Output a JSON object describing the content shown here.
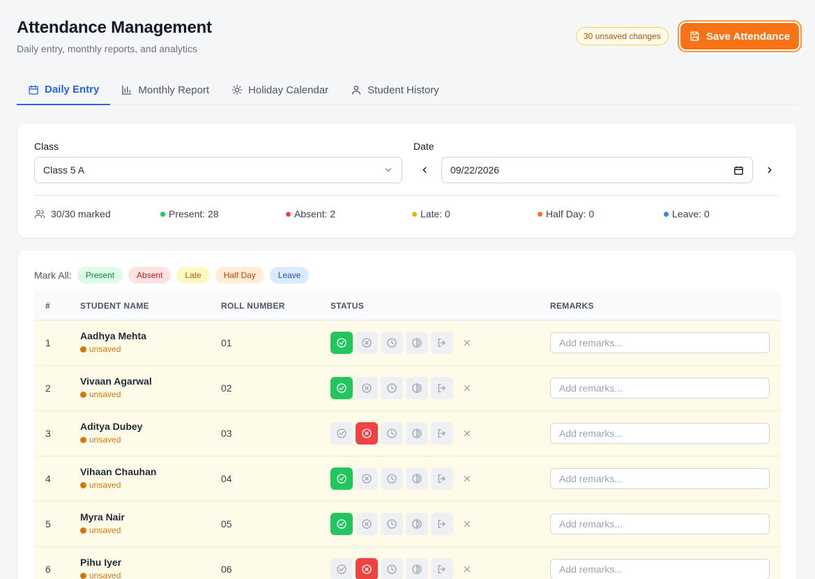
{
  "header": {
    "title": "Attendance Management",
    "subtitle": "Daily entry, monthly reports, and analytics",
    "unsaved_badge": "30 unsaved changes",
    "save_label": "Save Attendance"
  },
  "tabs": [
    {
      "label": "Daily Entry",
      "icon": "calendar-icon",
      "active": true
    },
    {
      "label": "Monthly Report",
      "icon": "bar-chart-icon",
      "active": false
    },
    {
      "label": "Holiday Calendar",
      "icon": "sun-icon",
      "active": false
    },
    {
      "label": "Student History",
      "icon": "user-icon",
      "active": false
    }
  ],
  "filters": {
    "class_label": "Class",
    "class_value": "Class 5 A",
    "date_label": "Date",
    "date_value": "09/22/2026"
  },
  "stats": {
    "marked": "30/30 marked",
    "present": "Present: 28",
    "absent": "Absent: 2",
    "late": "Late: 0",
    "half_day": "Half Day: 0",
    "leave": "Leave: 0"
  },
  "mark_all": {
    "label": "Mark All:",
    "present": "Present",
    "absent": "Absent",
    "late": "Late",
    "half_day": "Half Day",
    "leave": "Leave"
  },
  "table": {
    "headers": {
      "num": "#",
      "name": "STUDENT NAME",
      "roll": "ROLL NUMBER",
      "status": "STATUS",
      "remarks": "REMARKS"
    },
    "remarks_placeholder": "Add remarks...",
    "unsaved_label": "unsaved",
    "rows": [
      {
        "num": "1",
        "name": "Aadhya Mehta",
        "roll": "01",
        "status": "present"
      },
      {
        "num": "2",
        "name": "Vivaan Agarwal",
        "roll": "02",
        "status": "present"
      },
      {
        "num": "3",
        "name": "Aditya Dubey",
        "roll": "03",
        "status": "absent"
      },
      {
        "num": "4",
        "name": "Vihaan Chauhan",
        "roll": "04",
        "status": "present"
      },
      {
        "num": "5",
        "name": "Myra Nair",
        "roll": "05",
        "status": "present"
      },
      {
        "num": "6",
        "name": "Pihu Iyer",
        "roll": "06",
        "status": "absent"
      }
    ]
  },
  "colors": {
    "accent": "#2563eb",
    "save": "#f97316",
    "present": "#22c55e",
    "absent": "#ef4444",
    "late": "#eab308",
    "half_day": "#f97316",
    "leave": "#3b82f6"
  }
}
